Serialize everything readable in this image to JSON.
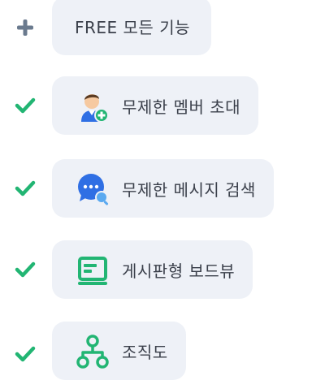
{
  "header": {
    "label": "FREE 모든 기능",
    "marker_icon": "plus-icon"
  },
  "features": [
    {
      "label": "무제한 멤버 초대",
      "icon": "member-invite-icon"
    },
    {
      "label": "무제한 메시지 검색",
      "icon": "message-search-icon"
    },
    {
      "label": "게시판형 보드뷰",
      "icon": "board-view-icon"
    },
    {
      "label": "조직도",
      "icon": "org-chart-icon"
    }
  ],
  "colors": {
    "check": "#22b573",
    "plus": "#6a7a8e",
    "pill_bg": "#eef1f7",
    "text": "#3a3f4a",
    "accent_blue": "#2f6fe4",
    "accent_green": "#22b573"
  }
}
